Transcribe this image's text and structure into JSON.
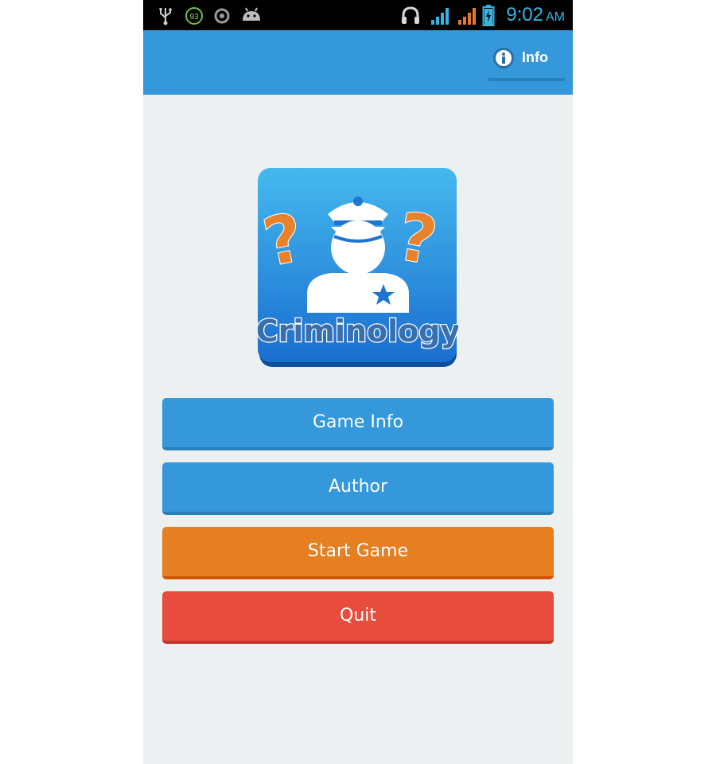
{
  "status_bar": {
    "time": "9:02",
    "ampm": "AM",
    "battery_circle_value": "93",
    "icons": [
      "usb-icon",
      "battery-level-icon",
      "sync-icon",
      "android-icon",
      "headset-icon",
      "signal-1-icon",
      "signal-2-icon",
      "battery-icon"
    ],
    "colors": {
      "accent": "#33b5e5",
      "signal_2": "#e8752f"
    }
  },
  "action_bar": {
    "info_label": "Info",
    "icon": "info-icon",
    "color": "#3498db"
  },
  "logo": {
    "text": "Criminology",
    "icon": "police-officer-icon"
  },
  "menu": {
    "game_info": "Game Info",
    "author": "Author",
    "start_game": "Start Game",
    "quit": "Quit"
  },
  "colors": {
    "blue": "#3498db",
    "orange": "#e67e22",
    "red": "#e74c3c",
    "background": "#ecf0f1"
  }
}
